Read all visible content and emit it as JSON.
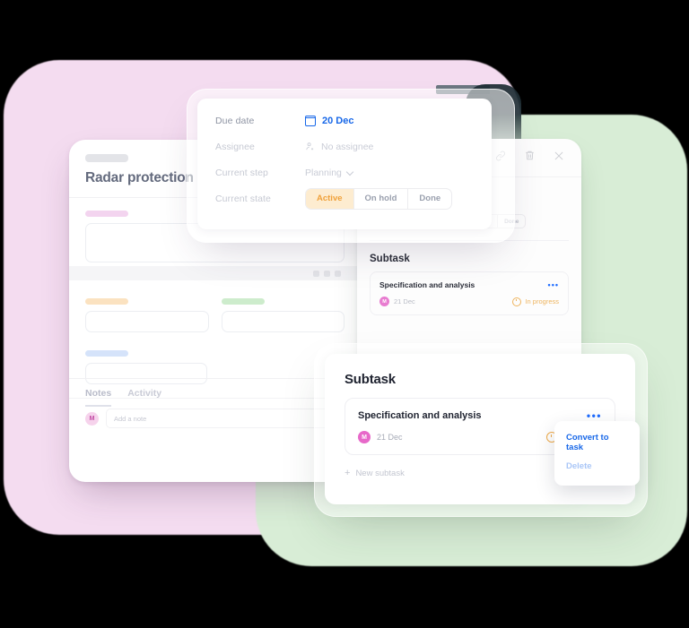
{
  "background": {
    "blob_pink_color": "#f4dcf0",
    "blob_green_color": "#d8edd6"
  },
  "left_card": {
    "title": "Radar protection",
    "tabs": [
      {
        "label": "Notes",
        "active": true
      },
      {
        "label": "Activity",
        "active": false
      }
    ],
    "note_avatar": "M",
    "note_placeholder": "Add a note"
  },
  "mid_card": {
    "toolbar_icons": [
      "binoculars-icon",
      "link-icon",
      "trash-icon",
      "close-icon"
    ],
    "rows": [
      {
        "label": "Current  step",
        "value": "Planning"
      },
      {
        "label": "Current  state",
        "value": "Active"
      }
    ],
    "state_options": [
      {
        "label": "Active",
        "active": true
      },
      {
        "label": "On hold",
        "active": false
      },
      {
        "label": "Done",
        "active": false
      }
    ],
    "subtask_heading": "Subtask",
    "subtask": {
      "title": "Specification and analysis",
      "avatar": "M",
      "date": "21 Dec",
      "status": "In progress"
    }
  },
  "popover": {
    "rows": [
      {
        "label": "Due date",
        "value": "20 Dec",
        "icon": "calendar-icon"
      },
      {
        "label": "Assignee",
        "value": "No assignee",
        "icon": "person-add-icon"
      },
      {
        "label": "Current  step",
        "value": "Planning",
        "icon": "chevron-down-icon"
      },
      {
        "label": "Current  state",
        "value": "Active",
        "icon": ""
      }
    ],
    "state_options": [
      {
        "label": "Active",
        "active": true
      },
      {
        "label": "On hold",
        "active": false
      },
      {
        "label": "Done",
        "active": false
      }
    ],
    "accent_color": "#1767e8",
    "active_chip_color": "#f0a13a"
  },
  "front_card": {
    "heading": "Subtask",
    "item": {
      "title": "Specification and analysis",
      "avatar": "M",
      "date": "21 Dec",
      "status": "In progress",
      "menu_icon": "ellipsis-icon"
    },
    "new_subtask_label": "New subtask",
    "new_subtask_plus": "+"
  },
  "context_menu": {
    "items": [
      {
        "label": "Convert to task",
        "state": "enabled"
      },
      {
        "label": "Delete",
        "state": "disabled"
      }
    ],
    "primary_color": "#1767e8",
    "disabled_color": "#a9c6f7"
  }
}
